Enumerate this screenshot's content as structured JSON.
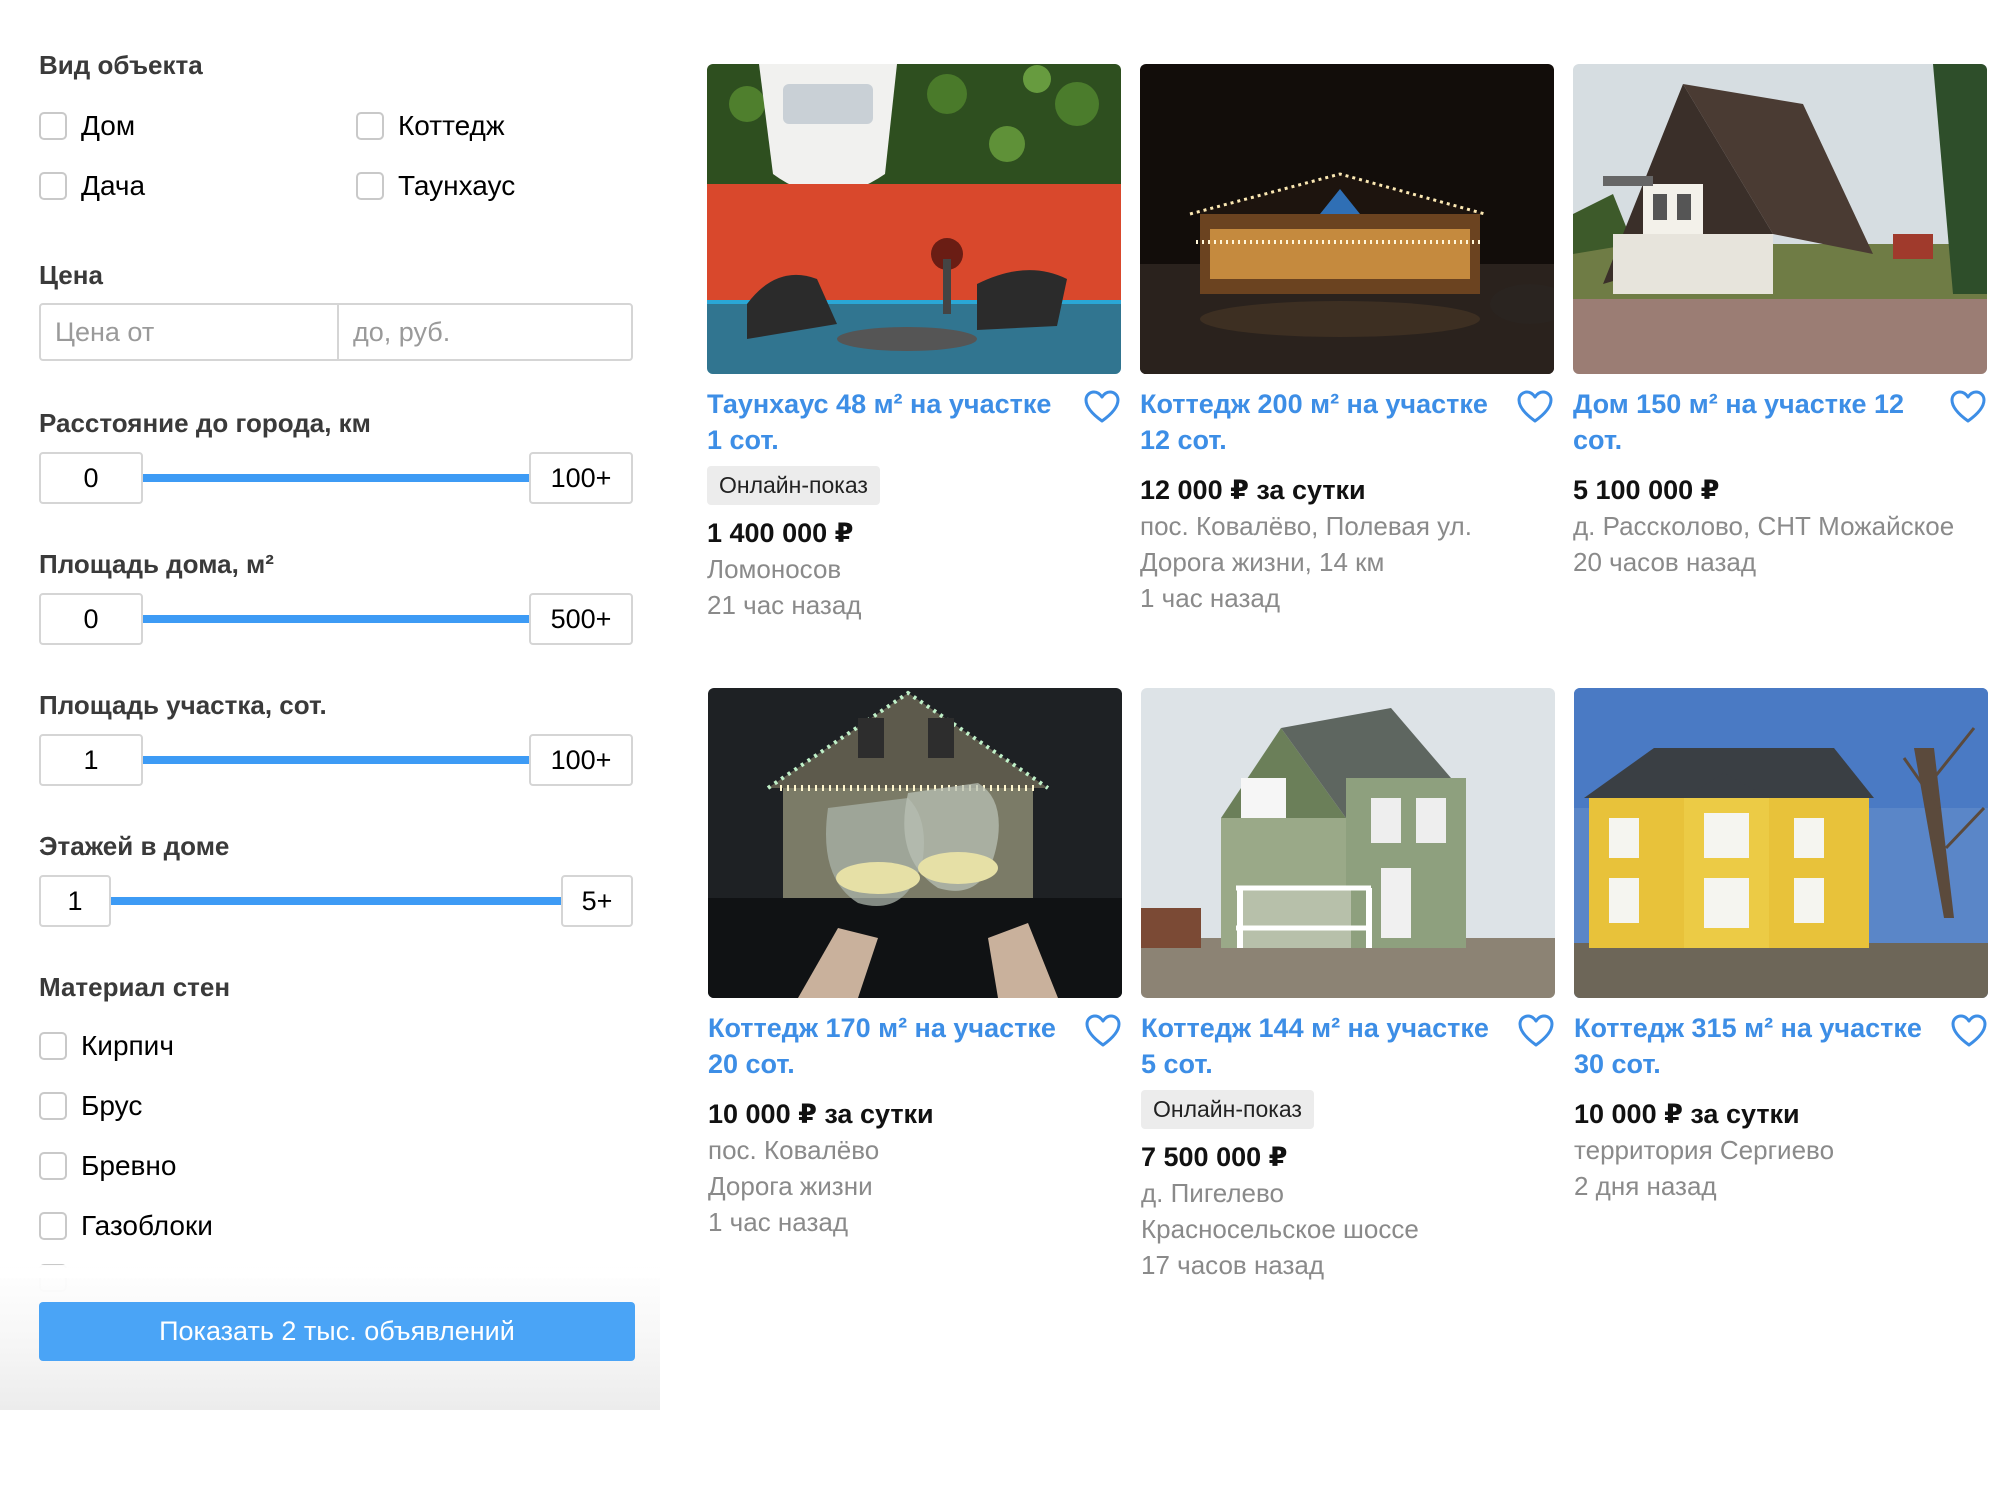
{
  "filters": {
    "object_type": {
      "title": "Вид объекта",
      "options": [
        "Дом",
        "Коттедж",
        "Дача",
        "Таунхаус"
      ]
    },
    "price": {
      "title": "Цена",
      "from_placeholder": "Цена от",
      "to_placeholder": "до, руб."
    },
    "distance": {
      "title": "Расстояние до города, км",
      "min": "0",
      "max": "100+"
    },
    "house_area": {
      "title": "Площадь дома, м²",
      "min": "0",
      "max": "500+"
    },
    "plot_area": {
      "title": "Площадь участка, сот.",
      "min": "1",
      "max": "100+"
    },
    "floors": {
      "title": "Этажей в доме",
      "min": "1",
      "max": "5+"
    },
    "wall_material": {
      "title": "Материал стен",
      "options": [
        "Кирпич",
        "Брус",
        "Бревно",
        "Газоблоки"
      ]
    },
    "show_button": "Показать 2 тыс. объявлений"
  },
  "listings": [
    {
      "title": "Таунхаус 48 м² на участке 1 сот.",
      "badge": "Онлайн-показ",
      "price": "1 400 000 ₽",
      "location": "Ломоносов",
      "location2": "",
      "time": "21 час назад"
    },
    {
      "title": "Коттедж 200 м² на участке 12 сот.",
      "badge": "",
      "price": "12 000 ₽ за сутки",
      "location": "пос. Ковалёво, Полевая ул.",
      "location2": "Дорога жизни, 14 км",
      "time": "1 час назад"
    },
    {
      "title": "Дом 150 м² на участке 12 сот.",
      "badge": "",
      "price": "5 100 000 ₽",
      "location": "д. Рассколово, СНТ Можайское",
      "location2": "",
      "time": "20 часов назад"
    },
    {
      "title": "Коттедж 170 м² на участке 20 сот.",
      "badge": "",
      "price": "10 000 ₽ за сутки",
      "location": "пос. Ковалёво",
      "location2": "Дорога жизни",
      "time": "1 час назад"
    },
    {
      "title": "Коттедж 144 м² на участке 5 сот.",
      "badge": "Онлайн-показ",
      "price": "7 500 000 ₽",
      "location": "д. Пигелево",
      "location2": "Красносельское шоссе",
      "time": "17 часов назад"
    },
    {
      "title": "Коттедж 315 м² на участке 30 сот.",
      "badge": "",
      "price": "10 000 ₽ за сутки",
      "location": "территория Сергиево",
      "location2": "",
      "time": "2 дня назад"
    }
  ],
  "colors": {
    "accent": "#4aa4f6",
    "link": "#3d8ee6",
    "slider": "#3d9bf5"
  }
}
